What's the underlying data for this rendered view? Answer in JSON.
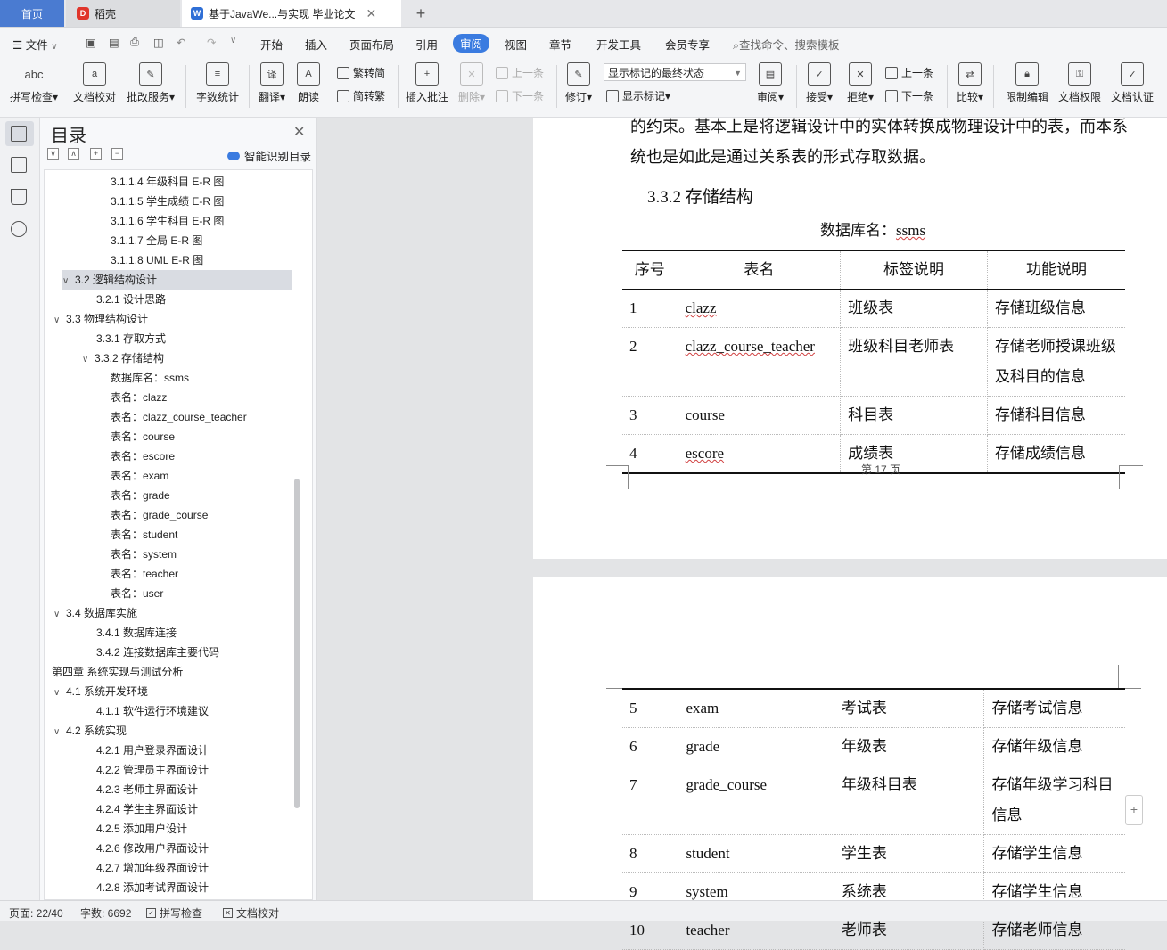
{
  "titlebar": {
    "tab_home": "首页",
    "tab_daoke": "稻壳",
    "tab_doc": "基于JavaWe...与实现 毕业论文"
  },
  "menubar": {
    "file": "文件",
    "items": [
      "开始",
      "插入",
      "页面布局",
      "引用",
      "审阅",
      "视图",
      "章节",
      "开发工具",
      "会员专享"
    ],
    "search_placeholder": "查找命令、搜索模板"
  },
  "ribbon": {
    "spell_check": "拼写检查",
    "doc_check": "文档校对",
    "revise_service": "批改服务",
    "word_count": "字数统计",
    "translate": "翻译",
    "read_aloud": "朗读",
    "trad_to_simp": "繁转简",
    "simp_to_trad": "简转繁",
    "insert_comment": "插入批注",
    "delete": "删除",
    "prev_comment": "上一条",
    "next_comment": "下一条",
    "track_changes": "修订",
    "display_mode": "显示标记的最终状态",
    "show_markup": "显示标记",
    "review": "审阅",
    "accept": "接受",
    "reject": "拒绝",
    "prev_change": "上一条",
    "next_change": "下一条",
    "compare": "比较",
    "restrict_edit": "限制编辑",
    "doc_permission": "文档权限",
    "doc_certify": "文档认证"
  },
  "toc": {
    "title": "目录",
    "smart_toc": "智能识别目录",
    "items": [
      {
        "text": "3.1.1.4  年级科目 E-R 图",
        "level": 4,
        "arrow": ""
      },
      {
        "text": "3.1.1.5  学生成绩 E-R 图",
        "level": 4,
        "arrow": ""
      },
      {
        "text": "3.1.1.6  学生科目 E-R 图",
        "level": 4,
        "arrow": ""
      },
      {
        "text": "3.1.1.7  全局 E-R 图",
        "level": 4,
        "arrow": ""
      },
      {
        "text": "3.1.1.8 UML E-R 图",
        "level": 4,
        "arrow": ""
      },
      {
        "text": "3.2 逻辑结构设计",
        "level": 2,
        "arrow": "⌄",
        "selected": true
      },
      {
        "text": "3.2.1 设计思路",
        "level": 3,
        "arrow": ""
      },
      {
        "text": "3.3 物理结构设计",
        "level": 2,
        "arrow": "⌄"
      },
      {
        "text": "3.3.1 存取方式",
        "level": 3,
        "arrow": ""
      },
      {
        "text": "3.3.2 存储结构",
        "level": 3,
        "arrow": "⌄"
      },
      {
        "text": "数据库名：ssms",
        "level": 4,
        "arrow": ""
      },
      {
        "text": "表名：clazz",
        "level": 4,
        "arrow": ""
      },
      {
        "text": "表名：clazz_course_teacher",
        "level": 4,
        "arrow": ""
      },
      {
        "text": "表名：course",
        "level": 4,
        "arrow": ""
      },
      {
        "text": "表名：escore",
        "level": 4,
        "arrow": ""
      },
      {
        "text": "表名：exam",
        "level": 4,
        "arrow": ""
      },
      {
        "text": "表名：grade",
        "level": 4,
        "arrow": ""
      },
      {
        "text": "表名：grade_course",
        "level": 4,
        "arrow": ""
      },
      {
        "text": "表名：student",
        "level": 4,
        "arrow": ""
      },
      {
        "text": "表名：system",
        "level": 4,
        "arrow": ""
      },
      {
        "text": "表名：teacher",
        "level": 4,
        "arrow": ""
      },
      {
        "text": "表名：user",
        "level": 4,
        "arrow": ""
      },
      {
        "text": "3.4 数据库实施",
        "level": 2,
        "arrow": "⌄"
      },
      {
        "text": "3.4.1 数据库连接",
        "level": 3,
        "arrow": ""
      },
      {
        "text": "3.4.2 连接数据库主要代码",
        "level": 3,
        "arrow": ""
      },
      {
        "text": "第四章  系统实现与测试分析",
        "level": 1,
        "arrow": "⌄"
      },
      {
        "text": "4.1 系统开发环境",
        "level": 2,
        "arrow": "⌄"
      },
      {
        "text": "4.1.1 软件运行环境建议",
        "level": 3,
        "arrow": ""
      },
      {
        "text": "4.2 系统实现",
        "level": 2,
        "arrow": "⌄"
      },
      {
        "text": "4.2.1 用户登录界面设计",
        "level": 3,
        "arrow": ""
      },
      {
        "text": "4.2.2 管理员主界面设计",
        "level": 3,
        "arrow": ""
      },
      {
        "text": "4.2.3 老师主界面设计",
        "level": 3,
        "arrow": ""
      },
      {
        "text": "4.2.4 学生主界面设计",
        "level": 3,
        "arrow": ""
      },
      {
        "text": "4.2.5 添加用户设计",
        "level": 3,
        "arrow": ""
      },
      {
        "text": "4.2.6 修改用户界面设计",
        "level": 3,
        "arrow": ""
      },
      {
        "text": "4.2.7 增加年级界面设计",
        "level": 3,
        "arrow": ""
      },
      {
        "text": "4.2.8 添加考试界面设计",
        "level": 3,
        "arrow": ""
      }
    ]
  },
  "document": {
    "para_line1": "的约束。基本上是将逻辑设计中的实体转换成物理设计中的表，而本系",
    "para_line2": "统也是如此是通过关系表的形式存取数据。",
    "heading": "3.3.2 存储结构",
    "db_label": "数据库名：",
    "db_name": "ssms",
    "table_headers": [
      "序号",
      "表名",
      "标签说明",
      "功能说明"
    ],
    "table1_rows": [
      [
        "1",
        "clazz",
        "班级表",
        "存储班级信息"
      ],
      [
        "2",
        "clazz_course_teacher",
        "班级科目老师表",
        "存储老师授课班级及科目的信息"
      ],
      [
        "3",
        "course",
        "科目表",
        "存储科目信息"
      ],
      [
        "4",
        "escore",
        "成绩表",
        "存储成绩信息"
      ]
    ],
    "page_footer": "第  17  页",
    "table2_rows": [
      [
        "5",
        "exam",
        "考试表",
        "存储考试信息"
      ],
      [
        "6",
        "grade",
        "年级表",
        "存储年级信息"
      ],
      [
        "7",
        "grade_course",
        "年级科目表",
        "存储年级学习科目信息"
      ],
      [
        "8",
        "student",
        "学生表",
        "存储学生信息"
      ],
      [
        "9",
        "system",
        "系统表",
        "存储学生信息"
      ],
      [
        "10",
        "teacher",
        "老师表",
        "存储老师信息"
      ]
    ]
  },
  "statusbar": {
    "page": "页面: 22/40",
    "words": "字数: 6692",
    "spell_check": "拼写检查",
    "doc_check": "文档校对"
  }
}
